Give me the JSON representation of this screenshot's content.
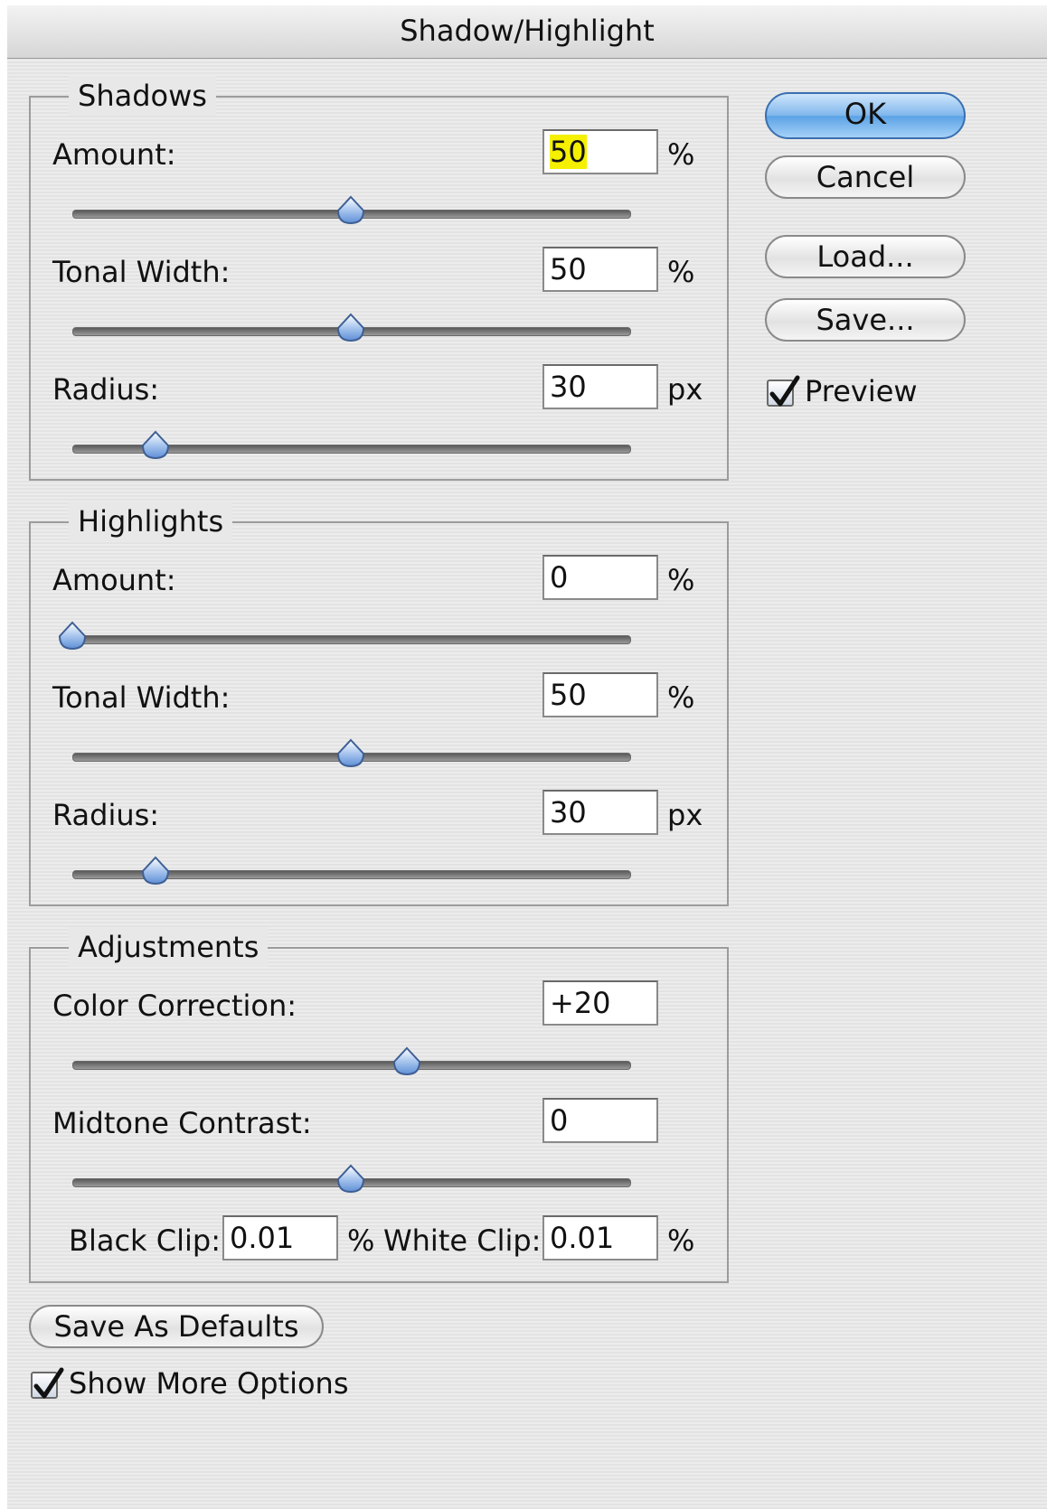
{
  "window": {
    "title": "Shadow/Highlight"
  },
  "shadows": {
    "title": "Shadows",
    "amount": {
      "label": "Amount:",
      "value": "50",
      "unit": "%",
      "slider_pct": 50
    },
    "tonal_width": {
      "label": "Tonal Width:",
      "value": "50",
      "unit": "%",
      "slider_pct": 50
    },
    "radius": {
      "label": "Radius:",
      "value": "30",
      "unit": "px",
      "slider_pct": 15
    }
  },
  "highlights": {
    "title": "Highlights",
    "amount": {
      "label": "Amount:",
      "value": "0",
      "unit": "%",
      "slider_pct": 0
    },
    "tonal_width": {
      "label": "Tonal Width:",
      "value": "50",
      "unit": "%",
      "slider_pct": 50
    },
    "radius": {
      "label": "Radius:",
      "value": "30",
      "unit": "px",
      "slider_pct": 15
    }
  },
  "adjustments": {
    "title": "Adjustments",
    "color_correction": {
      "label": "Color Correction:",
      "value": "+20",
      "slider_pct": 60
    },
    "midtone_contrast": {
      "label": "Midtone Contrast:",
      "value": "0",
      "slider_pct": 50
    },
    "black_clip": {
      "label": "Black Clip:",
      "value": "0.01",
      "unit": "%"
    },
    "white_clip": {
      "label": "White Clip:",
      "value": "0.01",
      "unit": "%"
    }
  },
  "buttons": {
    "ok": "OK",
    "cancel": "Cancel",
    "load": "Load...",
    "save": "Save...",
    "save_defaults": "Save As Defaults"
  },
  "preview": {
    "label": "Preview",
    "checked": true
  },
  "show_more": {
    "label": "Show More Options",
    "checked": true
  },
  "colors": {
    "highlight": "#f4f000",
    "accent": "#5aa2e6"
  }
}
